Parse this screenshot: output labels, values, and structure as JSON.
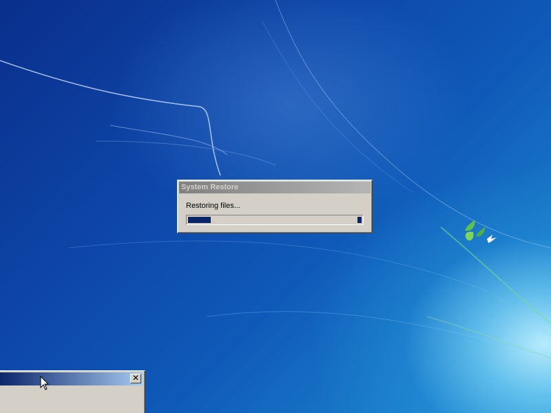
{
  "dialog": {
    "title": "System Restore",
    "status": "Restoring files...",
    "progress_fraction": 0.13
  },
  "secondary_window": {
    "close_glyph": "✕"
  },
  "colors": {
    "progress_fill": "#0a246a",
    "dialog_face": "#d4d0c8",
    "inactive_title_start": "#808080",
    "active_title_start": "#0a246a"
  },
  "icons": {
    "close": "close-icon",
    "cursor": "mouse-pointer-icon",
    "logo": "windows-flag-logo"
  }
}
